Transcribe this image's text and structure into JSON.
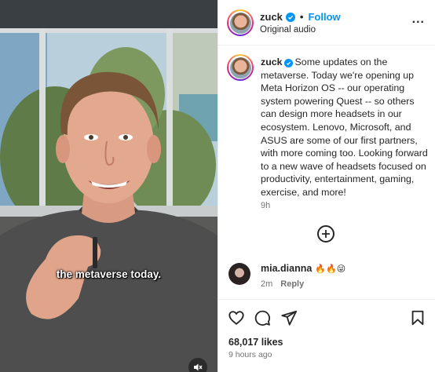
{
  "media": {
    "caption": "the metaverse today."
  },
  "header": {
    "username": "zuck",
    "separator": "•",
    "follow_label": "Follow",
    "audio": "Original audio",
    "more_label": "..."
  },
  "post": {
    "username": "zuck",
    "text": "Some updates on the metaverse. Today we're opening up Meta Horizon OS -- our operating system powering Quest -- so others can design more headsets in our ecosystem. Lenovo, Microsoft, and ASUS are some of our first partners, with more coming too. Looking forward to a new wave of headsets focused on productivity, entertainment, gaming, exercise, and more!",
    "time": "9h"
  },
  "comment": {
    "username": "mia.dianna",
    "emoji": "🔥🔥😜",
    "time": "2m",
    "reply_label": "Reply"
  },
  "footer": {
    "likes": "68,017 likes",
    "ago": "9 hours ago"
  },
  "colors": {
    "accent": "#0095f6",
    "text": "#262626",
    "muted": "#737373"
  },
  "icons": {
    "verified": "verified-badge-icon",
    "like": "heart-icon",
    "comment": "comment-bubble-icon",
    "share": "paper-plane-icon",
    "save": "bookmark-icon",
    "add": "plus-circle-icon",
    "mute": "speaker-muted-icon",
    "more": "more-dots-icon"
  }
}
